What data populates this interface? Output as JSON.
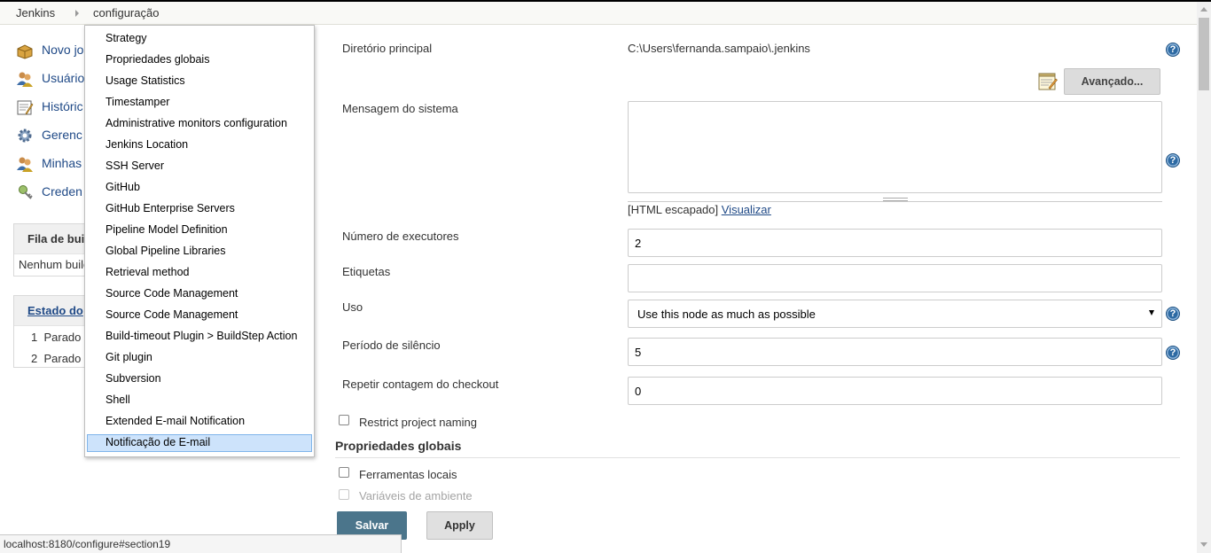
{
  "breadcrumb": {
    "items": [
      "Jenkins",
      "configuração"
    ]
  },
  "sidebar": {
    "links": [
      {
        "label": "Novo jo",
        "icon": "new-item-icon"
      },
      {
        "label": "Usuário",
        "icon": "users-icon"
      },
      {
        "label": "Históric",
        "icon": "history-icon"
      },
      {
        "label": "Gerenc",
        "icon": "gear-icon"
      },
      {
        "label": "Minhas",
        "icon": "users-icon"
      },
      {
        "label": "Creden",
        "icon": "credentials-icon"
      }
    ],
    "build_queue": {
      "title": "Fila de bui",
      "body": "Nenhum build"
    },
    "executor_status": {
      "title": "Estado do",
      "rows": [
        {
          "num": "1",
          "state": "Parado"
        },
        {
          "num": "2",
          "state": "Parado"
        }
      ]
    }
  },
  "section_menu": {
    "items": [
      "Strategy",
      "Propriedades globais",
      "Usage Statistics",
      "Timestamper",
      "Administrative monitors configuration",
      "Jenkins Location",
      "SSH Server",
      "GitHub",
      "GitHub Enterprise Servers",
      "Pipeline Model Definition",
      "Global Pipeline Libraries",
      "Retrieval method",
      "Source Code Management",
      "Source Code Management",
      "Build-timeout Plugin > BuildStep Action",
      "Git plugin",
      "Subversion",
      "Shell",
      "Extended E-mail Notification",
      "Notificação de E-mail"
    ],
    "selected_index": 19
  },
  "form": {
    "home_dir": {
      "label": "Diretório principal",
      "value": "C:\\Users\\fernanda.sampaio\\.jenkins"
    },
    "advanced_button": "Avançado...",
    "system_message": {
      "label": "Mensagem do sistema",
      "value": "",
      "note": "[HTML escapado]",
      "preview_link": "Visualizar"
    },
    "executors": {
      "label": "Número de executores",
      "value": "2"
    },
    "labels": {
      "label": "Etiquetas",
      "value": ""
    },
    "usage": {
      "label": "Uso",
      "selected": "Use this node as much as possible"
    },
    "quiet_period": {
      "label": "Período de silêncio",
      "value": "5"
    },
    "checkout_retry": {
      "label": "Repetir contagem do checkout",
      "value": "0"
    },
    "restrict_naming": {
      "label": "Restrict project naming",
      "checked": false
    },
    "global_properties": {
      "title": "Propriedades globais",
      "tools": {
        "label": "Ferramentas locais",
        "checked": false
      },
      "env_vars": {
        "label": "Variáveis de ambiente",
        "checked": false
      }
    },
    "help_glyph": "?"
  },
  "buttons": {
    "save": "Salvar",
    "apply": "Apply"
  },
  "status_bar": {
    "url": "localhost:8180/configure#section19"
  },
  "colors": {
    "link": "#204a87",
    "save_button": "#4b758b",
    "help_icon": "#2d6aa3",
    "menu_selected": "#cde3fb"
  }
}
